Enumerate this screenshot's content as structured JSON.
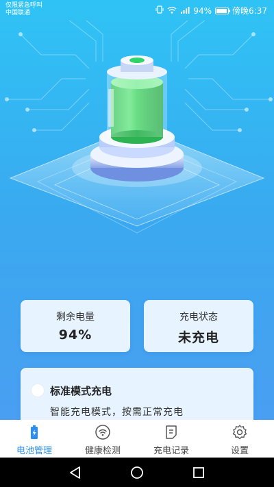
{
  "status_bar": {
    "carrier_line1": "仅限紧急呼叫",
    "carrier_line2": "中国联通",
    "battery_percent": "94%",
    "time": "傍晚6:37",
    "battery_level": 0.94
  },
  "colors": {
    "accent": "#2a8ff0",
    "battery_green": "#3fd36a",
    "background_top": "#2fc3f5",
    "background_bottom": "#4f9bf2"
  },
  "stats": {
    "remaining_label": "剩余电量",
    "remaining_value": "94%",
    "charge_status_label": "充电状态",
    "charge_status_value": "未充电"
  },
  "mode": {
    "title": "标准模式充电",
    "description": "智能充电模式，按需正常充电",
    "selected": false
  },
  "tabs": [
    {
      "label": "电池管理",
      "icon": "battery-icon",
      "active": true
    },
    {
      "label": "健康检测",
      "icon": "wifi-icon",
      "active": false
    },
    {
      "label": "充电记录",
      "icon": "record-icon",
      "active": false
    },
    {
      "label": "设置",
      "icon": "gear-icon",
      "active": false
    }
  ]
}
